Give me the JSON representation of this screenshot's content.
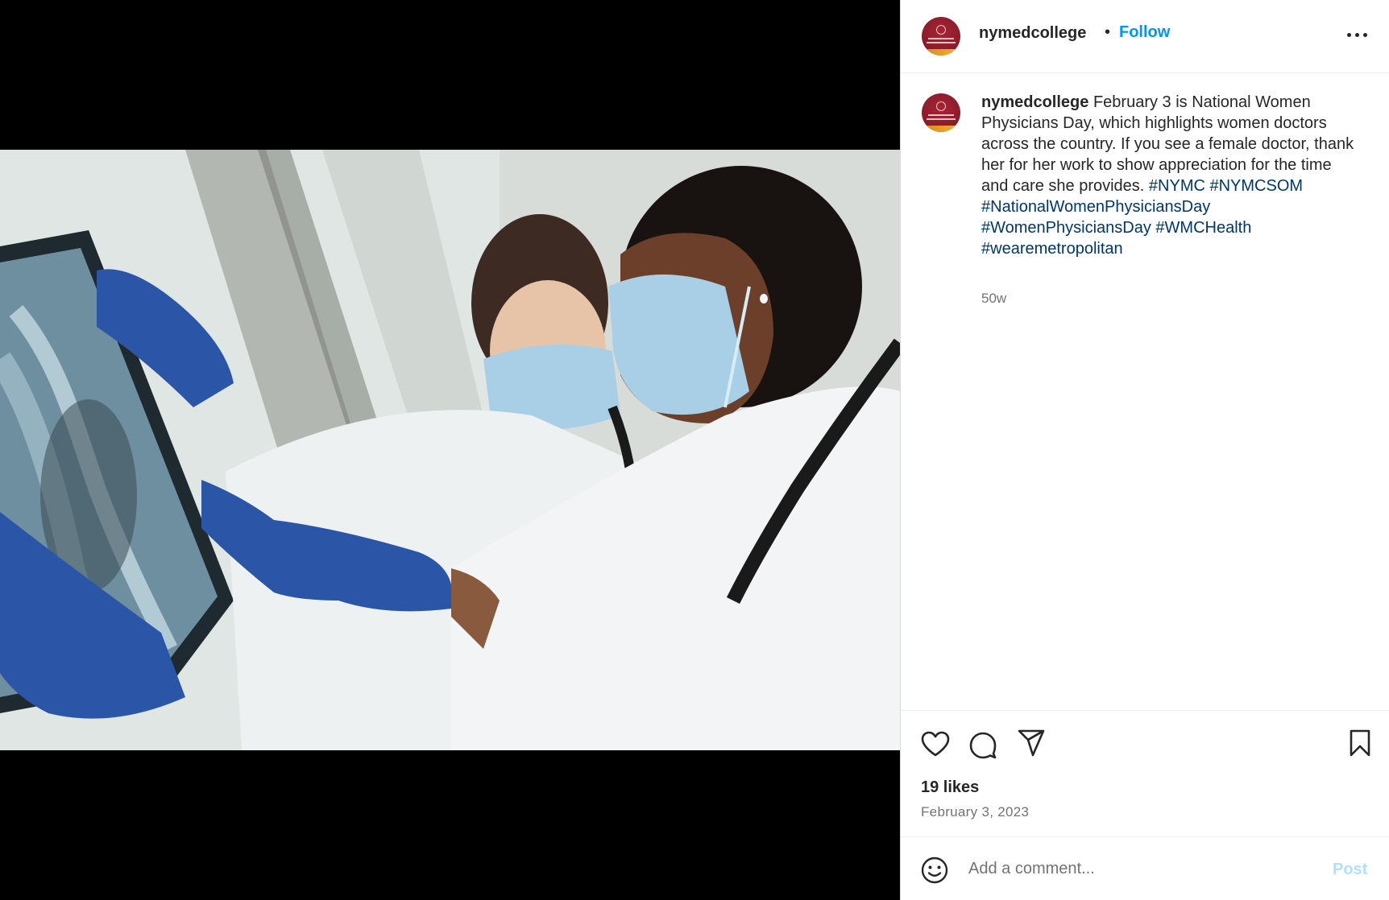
{
  "post": {
    "username": "nymedcollege",
    "separator": "•",
    "follow_label": "Follow",
    "more_icon": "more-horizontal-icon"
  },
  "media": {
    "image_icon": "photo-two-doctors-xray",
    "colors": {
      "letterbox": "#000000",
      "glove": "#2b55a6",
      "mask": "#a9cfe6",
      "coat": "#eef1f2"
    }
  },
  "caption": {
    "username": "nymedcollege",
    "text": "February 3 is National Women Physicians Day, which highlights women doctors across the country. If you see a female doctor, thank her for her work to show appreciation for the time and care she provides.",
    "hashtags": [
      "#NYMC",
      "#NYMCSOM",
      "#NationalWomenPhysiciansDay",
      "#WomenPhysiciansDay",
      "#WMCHealth",
      "#wearemetropolitan"
    ],
    "time": "50w"
  },
  "actions": {
    "icons": [
      "heart-icon",
      "comment-icon",
      "share-icon",
      "bookmark-icon"
    ],
    "likes": "19 likes",
    "date": "February 3, 2023"
  },
  "comment_box": {
    "placeholder": "Add a comment...",
    "post_label": "Post",
    "emoji_icon": "emoji-icon"
  },
  "colors": {
    "link_blue": "#0095f6",
    "hashtag_blue": "#00376b",
    "muted": "#737373",
    "text": "#262626",
    "brand_maroon": "#8a1a2a",
    "brand_gold": "#f0b233"
  }
}
